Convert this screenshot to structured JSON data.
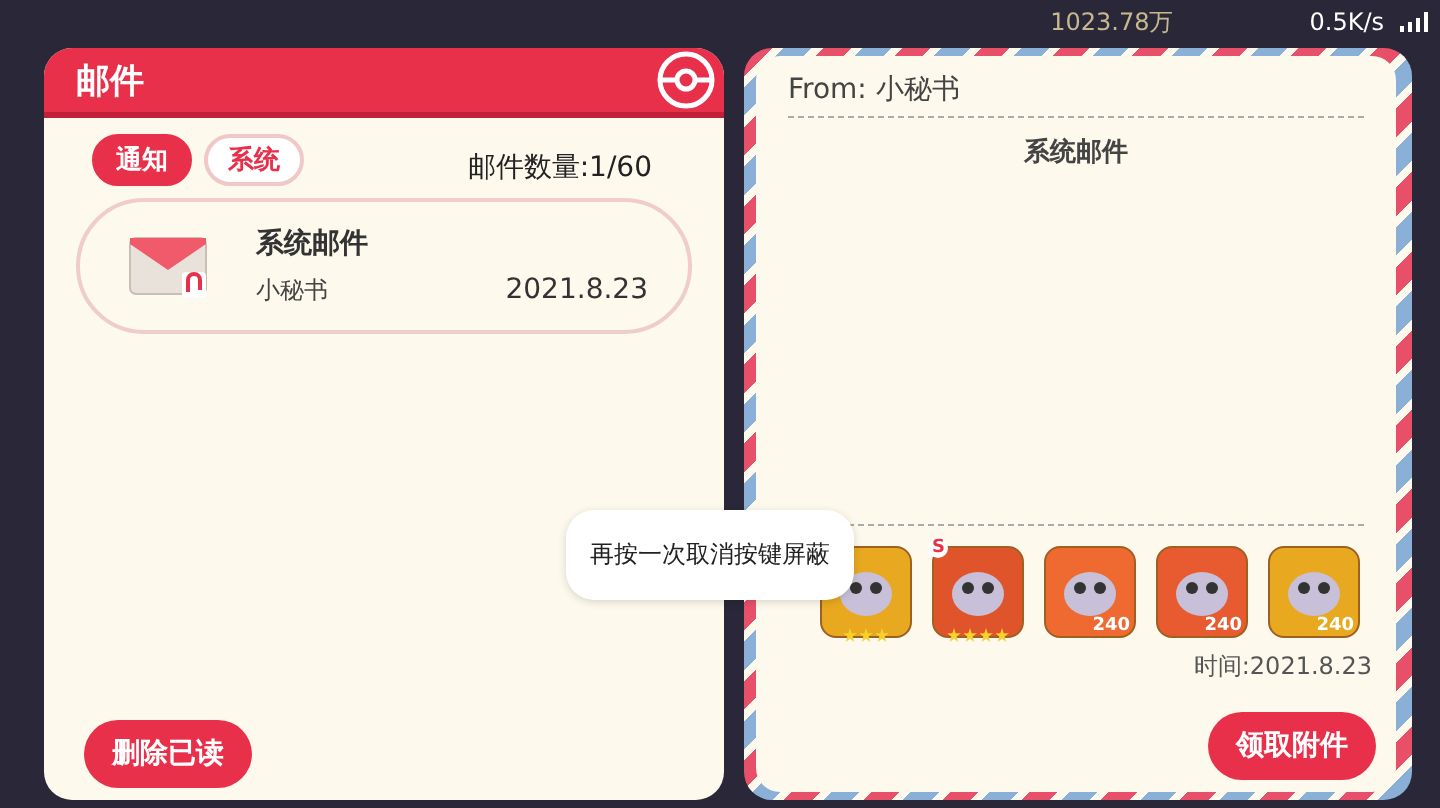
{
  "status_bar": {
    "coins": "1023.78万",
    "speed": "0.5K/s"
  },
  "mail_list": {
    "title": "邮件",
    "tabs": [
      {
        "label": "通知",
        "selected": true
      },
      {
        "label": "系统",
        "selected": false
      }
    ],
    "count_label": "邮件数量:1/60",
    "mails": [
      {
        "subject": "系统邮件",
        "sender": "小秘书",
        "date": "2021.8.23",
        "has_attachment": true
      }
    ],
    "delete_button": "删除已读"
  },
  "mail_detail": {
    "from": "From: 小秘书",
    "subject": "系统邮件",
    "attachments": [
      {
        "color": "#e8a820",
        "stars": 3
      },
      {
        "color": "#e0542c",
        "stars": 4,
        "badge": "S"
      },
      {
        "color": "#ee6a30",
        "quantity": "240"
      },
      {
        "color": "#e85a30",
        "quantity": "240"
      },
      {
        "color": "#e8a820",
        "quantity": "240"
      }
    ],
    "time": "时间:2021.8.23",
    "claim_button": "领取附件"
  },
  "toast": "再按一次取消按键屏蔽"
}
